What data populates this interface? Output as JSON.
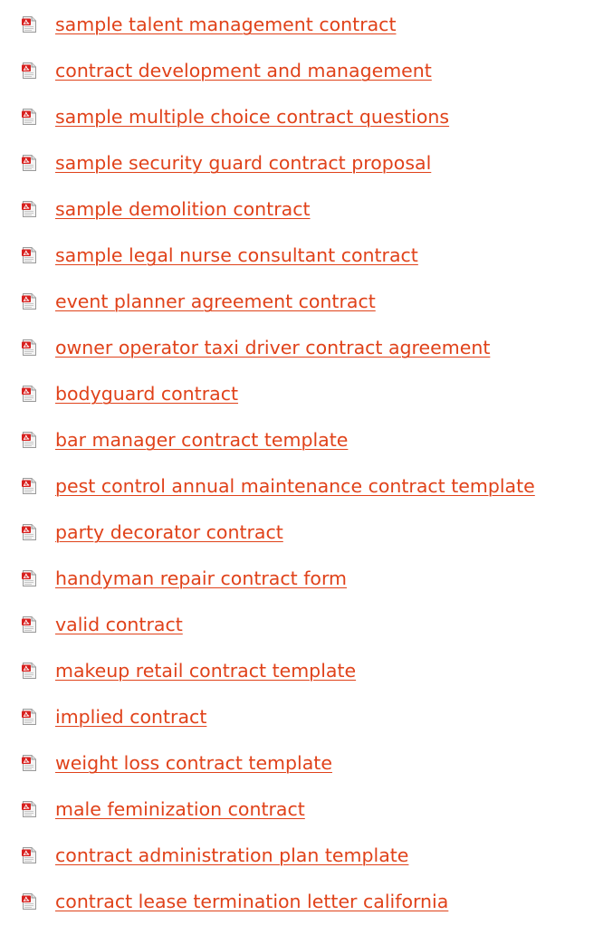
{
  "link_color": "#e0421a",
  "icon": "pdf-file-icon",
  "documents": [
    {
      "label": "sample talent management contract"
    },
    {
      "label": "contract development and management"
    },
    {
      "label": "sample multiple choice contract questions"
    },
    {
      "label": "sample security guard contract proposal"
    },
    {
      "label": "sample demolition contract"
    },
    {
      "label": "sample legal nurse consultant contract"
    },
    {
      "label": "event planner agreement contract"
    },
    {
      "label": "owner operator taxi driver contract agreement"
    },
    {
      "label": "bodyguard contract"
    },
    {
      "label": "bar manager contract template"
    },
    {
      "label": "pest control annual maintenance contract template"
    },
    {
      "label": "party decorator contract"
    },
    {
      "label": "handyman repair contract form"
    },
    {
      "label": "valid contract"
    },
    {
      "label": "makeup retail contract template"
    },
    {
      "label": "implied contract"
    },
    {
      "label": "weight loss contract template"
    },
    {
      "label": "male feminization contract"
    },
    {
      "label": "contract administration plan template"
    },
    {
      "label": "contract lease termination letter california"
    }
  ]
}
